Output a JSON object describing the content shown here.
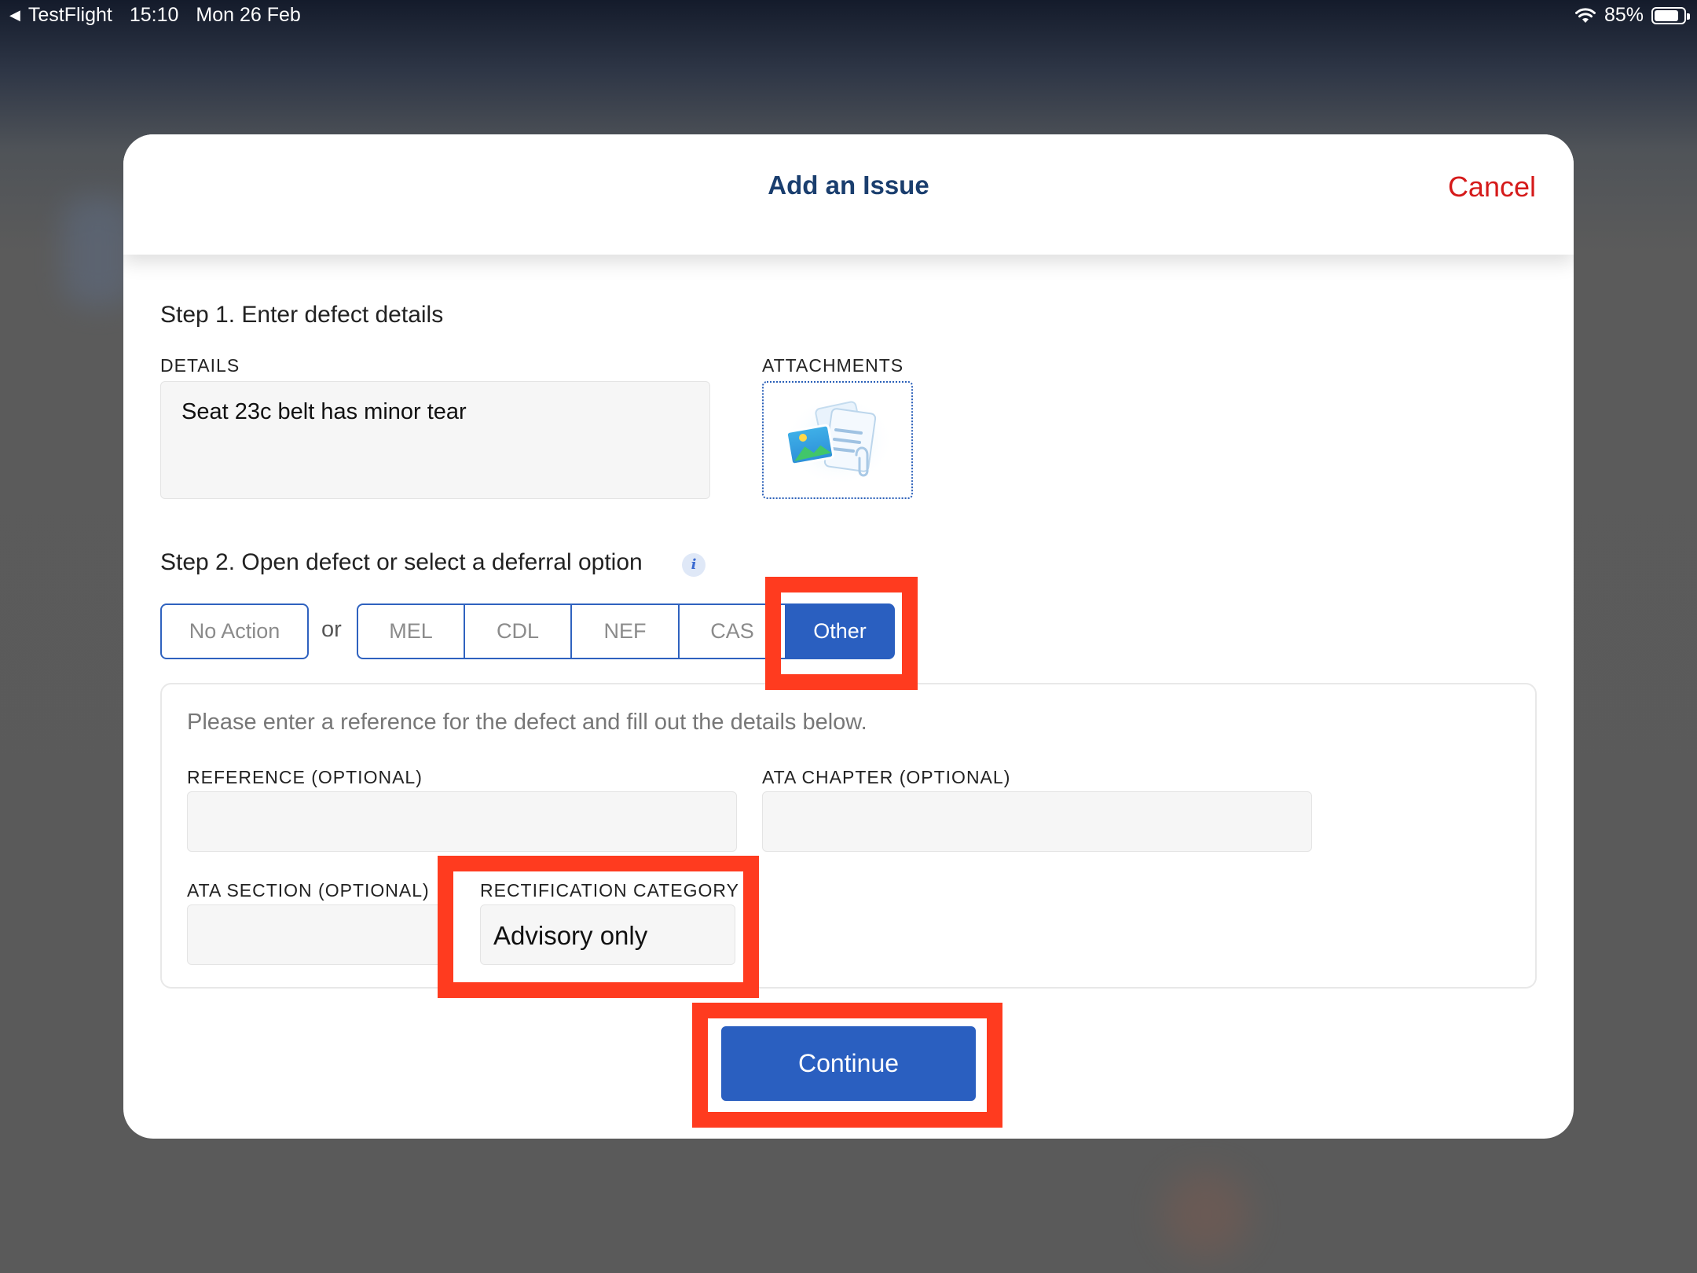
{
  "status_bar": {
    "back_app": "TestFlight",
    "time": "15:10",
    "date": "Mon 26 Feb",
    "battery": "85%",
    "battery_level": 0.85
  },
  "modal": {
    "title": "Add an Issue",
    "cancel_label": "Cancel"
  },
  "step1": {
    "title": "Step 1. Enter defect details",
    "details_label": "DETAILS",
    "details_value": "Seat 23c belt has minor tear",
    "attachments_label": "ATTACHMENTS"
  },
  "step2": {
    "title": "Step 2. Open defect or select a deferral option",
    "no_action_label": "No Action",
    "or_label": "or",
    "options": [
      {
        "label": "MEL",
        "selected": false
      },
      {
        "label": "CDL",
        "selected": false
      },
      {
        "label": "NEF",
        "selected": false
      },
      {
        "label": "CAS",
        "selected": false
      },
      {
        "label": "Other",
        "selected": true
      }
    ]
  },
  "other_panel": {
    "help_text": "Please enter a reference for the defect and fill out the details below.",
    "reference_label": "REFERENCE (OPTIONAL)",
    "reference_value": "",
    "ata_chapter_label": "ATA CHAPTER (OPTIONAL)",
    "ata_chapter_value": "",
    "ata_section_label": "ATA SECTION (OPTIONAL)",
    "ata_section_value": "",
    "rectification_label": "RECTIFICATION CATEGORY",
    "rectification_value": "Advisory only"
  },
  "continue_label": "Continue",
  "colors": {
    "accent": "#2a5fc0",
    "title": "#1a3e6e",
    "cancel": "#d51a1a",
    "annotation": "#ff3b1f"
  }
}
